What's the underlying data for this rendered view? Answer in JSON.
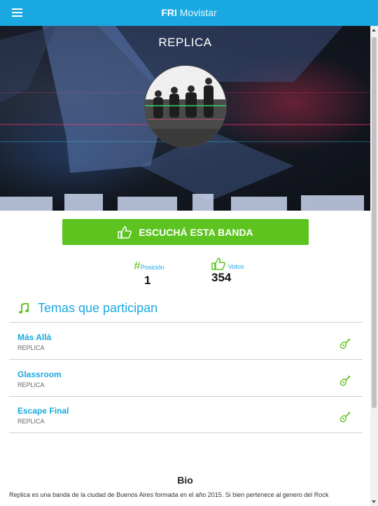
{
  "header": {
    "brand_bold": "FRI",
    "brand_thin": "Movistar",
    "menu_icon": "hamburger-menu-icon",
    "bg_color": "#19a9e0"
  },
  "hero": {
    "band_name": "REPLICA"
  },
  "listen_button": {
    "label": "ESCUCHÁ ESTA BANDA",
    "icon": "thumbs-up-icon",
    "color": "#5cc31f"
  },
  "stats": {
    "position": {
      "symbol": "#",
      "label": "Posición",
      "value": "1"
    },
    "votes": {
      "icon": "thumbs-up-icon",
      "label": "Votos",
      "value": "354"
    }
  },
  "tracks_section": {
    "title": "Temas que participan",
    "icon": "music-note-icon",
    "tracks": [
      {
        "name": "Más Allá",
        "artist": "REPLICA",
        "icon": "guitar-icon"
      },
      {
        "name": "Glassroom",
        "artist": "REPLICA",
        "icon": "guitar-icon"
      },
      {
        "name": "Escape Final",
        "artist": "REPLICA",
        "icon": "guitar-icon"
      }
    ]
  },
  "bio": {
    "title": "Bio",
    "text": "Replica es una banda de la ciudad de Buenos Aires formada en el año 2015. Si bien pertenece al genero del Rock"
  }
}
